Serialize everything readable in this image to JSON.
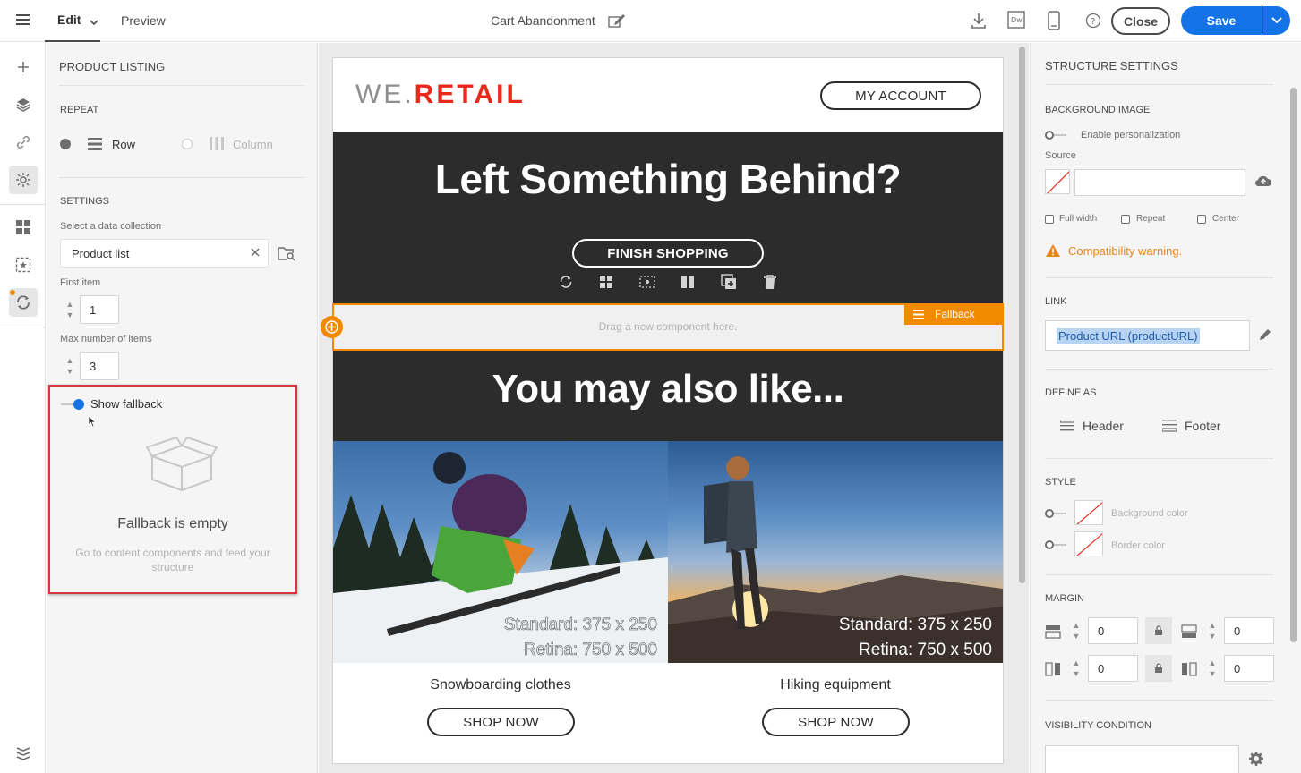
{
  "topbar": {
    "edit_label": "Edit",
    "preview_label": "Preview",
    "doc_title": "Cart Abandonment",
    "close_label": "Close",
    "save_label": "Save"
  },
  "left_panel": {
    "title": "PRODUCT LISTING",
    "repeat_label": "REPEAT",
    "row_label": "Row",
    "column_label": "Column",
    "settings_label": "SETTINGS",
    "select_collection_label": "Select a data collection",
    "collection_value": "Product list",
    "first_item_label": "First item",
    "first_item_value": "1",
    "max_items_label": "Max number of items",
    "max_items_value": "3",
    "show_fallback_label": "Show fallback",
    "fallback_empty_title": "Fallback is empty",
    "fallback_empty_desc": "Go to content components and feed your structure"
  },
  "email": {
    "logo_left": "WE.",
    "logo_right": "RETAIL",
    "my_account": "MY ACCOUNT",
    "hero_title": "Left Something Behind?",
    "finish_shopping": "FINISH SHOPPING",
    "drag_hint": "Drag a new component here.",
    "fallback_tag": "Fallback",
    "also_like": "You may also like...",
    "products": [
      {
        "name": "Snowboarding clothes",
        "cta": "SHOP NOW",
        "std": "Standard: 375 x 250",
        "ret": "Retina: 750 x 500"
      },
      {
        "name": "Hiking equipment",
        "cta": "SHOP NOW",
        "std": "Standard: 375 x 250",
        "ret": "Retina: 750 x 500"
      }
    ]
  },
  "right_panel": {
    "title": "STRUCTURE SETTINGS",
    "bg_image_label": "BACKGROUND IMAGE",
    "enable_personalization": "Enable personalization",
    "source_label": "Source",
    "full_width": "Full width",
    "repeat": "Repeat",
    "center": "Center",
    "compat_warning": "Compatibility warning.",
    "link_label": "LINK",
    "link_value": "Product URL (productURL)",
    "define_as_label": "DEFINE AS",
    "header_label": "Header",
    "footer_label": "Footer",
    "style_label": "STYLE",
    "bg_color_label": "Background color",
    "border_color_label": "Border color",
    "margin_label": "MARGIN",
    "margin_top": "0",
    "margin_bottom": "0",
    "margin_left": "0",
    "margin_right": "0",
    "visibility_label": "VISIBILITY CONDITION"
  },
  "colors": {
    "accent": "#1473e6",
    "fallback_orange": "#f28a00",
    "brand_red": "#e8291c",
    "warning": "#e68619"
  }
}
